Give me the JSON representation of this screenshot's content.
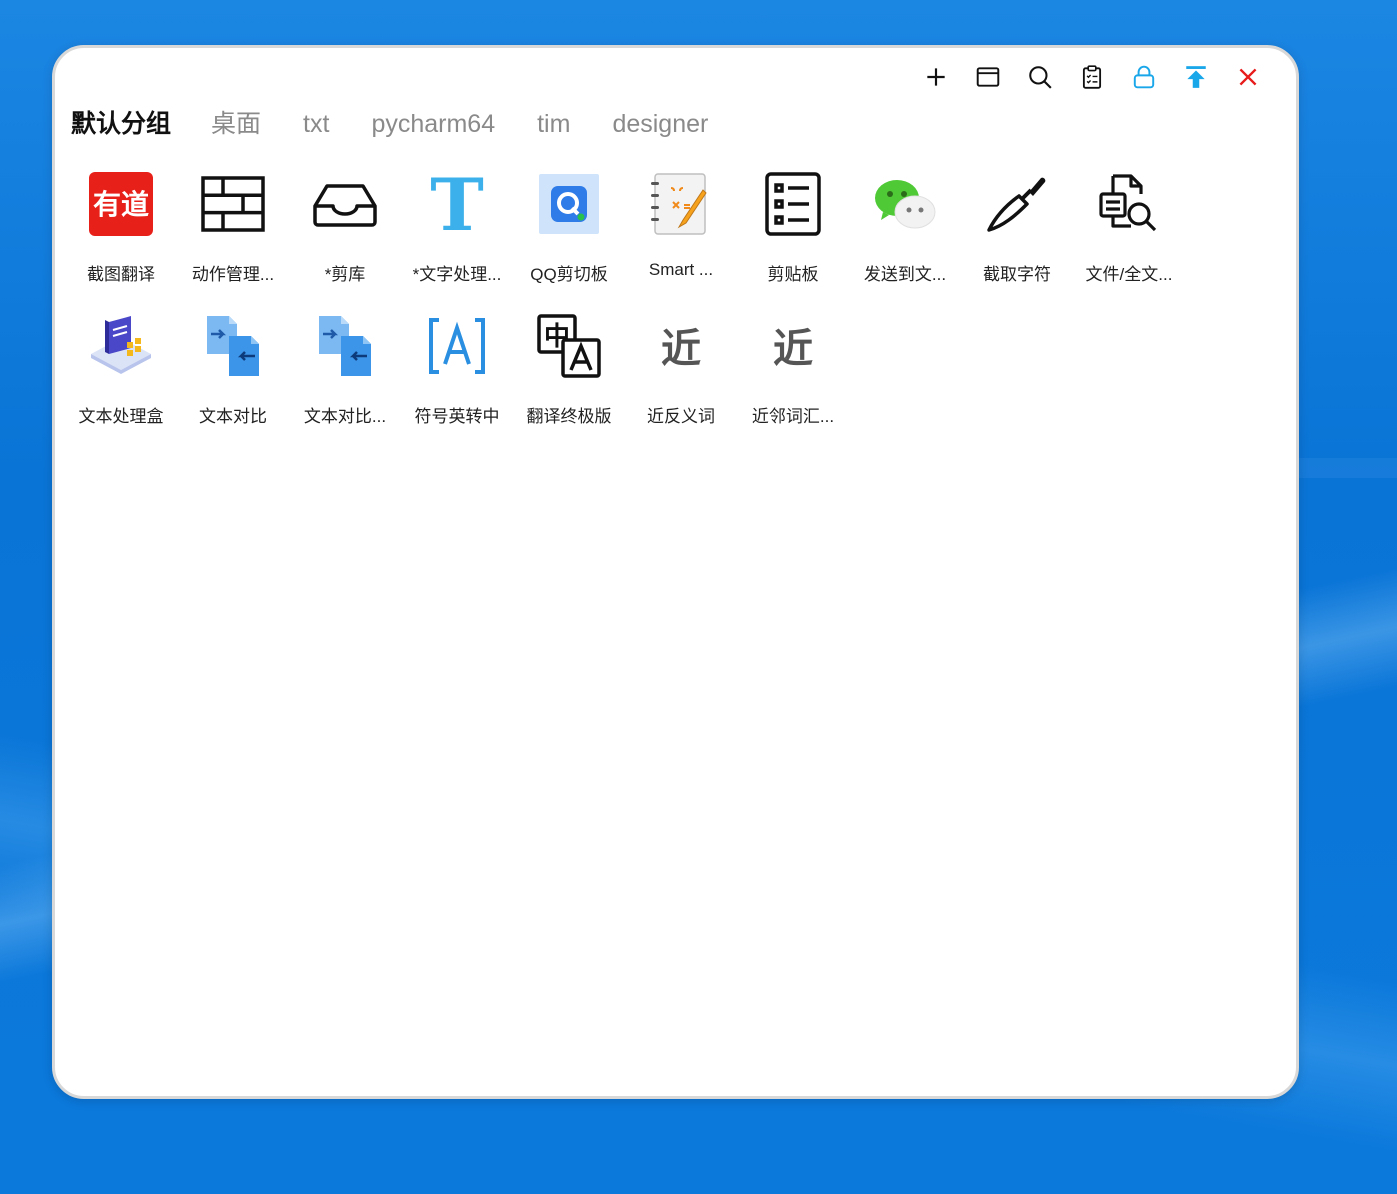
{
  "window": {
    "toolbar": [
      {
        "name": "add-icon",
        "color": "#111111"
      },
      {
        "name": "window-icon",
        "color": "#111111"
      },
      {
        "name": "search-icon",
        "color": "#111111"
      },
      {
        "name": "clipboard-list-icon",
        "color": "#111111"
      },
      {
        "name": "lock-icon",
        "color": "#1aa7ea"
      },
      {
        "name": "pin-top-icon",
        "color": "#1aa7ea"
      },
      {
        "name": "close-icon",
        "color": "#e81b1b"
      }
    ],
    "tabs": [
      {
        "label": "默认分组",
        "active": true
      },
      {
        "label": "桌面"
      },
      {
        "label": "txt"
      },
      {
        "label": "pycharm64"
      },
      {
        "label": "tim"
      },
      {
        "label": "designer"
      }
    ],
    "items": [
      {
        "label": "截图翻译",
        "icon": "youdao-icon",
        "icon_text": "有道"
      },
      {
        "label": "动作管理...",
        "icon": "brick-wall-icon"
      },
      {
        "label": "*剪库",
        "icon": "inbox-tray-icon"
      },
      {
        "label": "*文字处理...",
        "icon": "letter-t-icon",
        "icon_text": "T"
      },
      {
        "label": "QQ剪切板",
        "icon": "qq-clipboard-icon"
      },
      {
        "label": "Smart ...",
        "icon": "math-notebook-icon"
      },
      {
        "label": "剪贴板",
        "icon": "list-document-icon"
      },
      {
        "label": "发送到文...",
        "icon": "wechat-icon"
      },
      {
        "label": "截取字符",
        "icon": "knife-icon"
      },
      {
        "label": "文件/全文...",
        "icon": "file-search-icon"
      },
      {
        "label": "文本处理盒",
        "icon": "text-box-isometric-icon"
      },
      {
        "label": "文本对比",
        "icon": "text-compare-icon"
      },
      {
        "label": "文本对比...",
        "icon": "text-compare-icon"
      },
      {
        "label": "符号英转中",
        "icon": "bracket-a-icon"
      },
      {
        "label": "翻译终极版",
        "icon": "translate-icon",
        "icon_text": "中"
      },
      {
        "label": "近反义词",
        "icon": "jin-character-icon",
        "icon_text": "近"
      },
      {
        "label": "近邻词汇...",
        "icon": "jin-character-icon",
        "icon_text": "近"
      }
    ]
  }
}
